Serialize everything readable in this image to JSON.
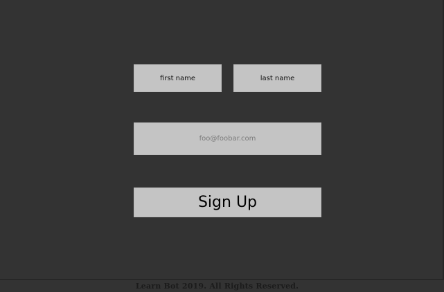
{
  "form": {
    "first_name_placeholder": "first name",
    "last_name_placeholder": "last name",
    "email_placeholder": "foo@foobar.com",
    "signup_label": "Sign Up"
  },
  "footer": {
    "copyright": "Learn Bot 2019. All Rights Reserved."
  }
}
